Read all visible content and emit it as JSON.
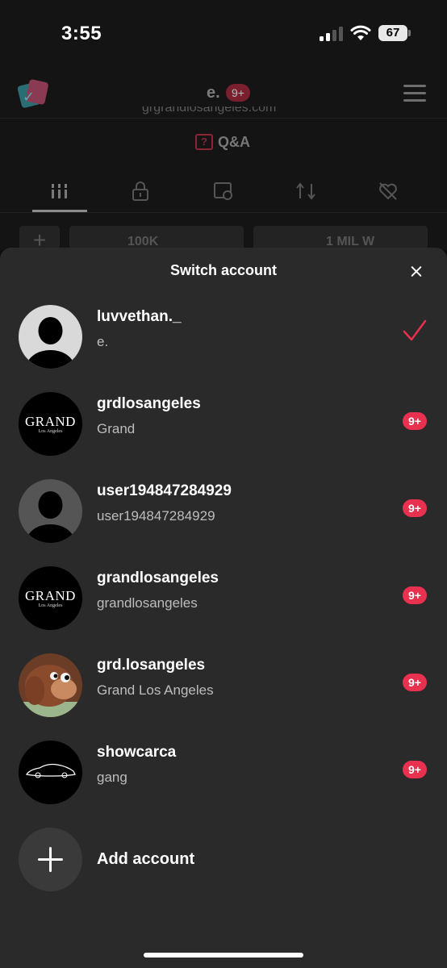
{
  "status_bar": {
    "time": "3:55",
    "battery": "67"
  },
  "profile": {
    "name": "e.",
    "badge": "9+",
    "qa_label": "Q&A",
    "stats": [
      "100K",
      "1 MIL W"
    ]
  },
  "sheet": {
    "title": "Switch account",
    "accounts": [
      {
        "username": "luvvethan._",
        "display_name": "e.",
        "selected": true,
        "avatar": "default-light"
      },
      {
        "username": "grdlosangeles",
        "display_name": "Grand",
        "badge": "9+",
        "avatar": "grand-logo"
      },
      {
        "username": "user194847284929",
        "display_name": "user194847284929",
        "badge": "9+",
        "avatar": "default-dark"
      },
      {
        "username": "grandlosangeles",
        "display_name": "grandlosangeles",
        "badge": "9+",
        "avatar": "grand-logo"
      },
      {
        "username": "grd.losangeles",
        "display_name": "Grand Los Angeles",
        "badge": "9+",
        "avatar": "monkey-photo"
      },
      {
        "username": "showcarca",
        "display_name": "gang",
        "badge": "9+",
        "avatar": "car-silhouette"
      }
    ],
    "add_account_label": "Add account"
  },
  "avatar_logo": {
    "grand_text": "GRAND",
    "grand_sub": "Los Angeles"
  },
  "colors": {
    "accent": "#e8304f",
    "sheet_bg": "#2a2a2a",
    "page_bg": "#0d0d0d"
  }
}
